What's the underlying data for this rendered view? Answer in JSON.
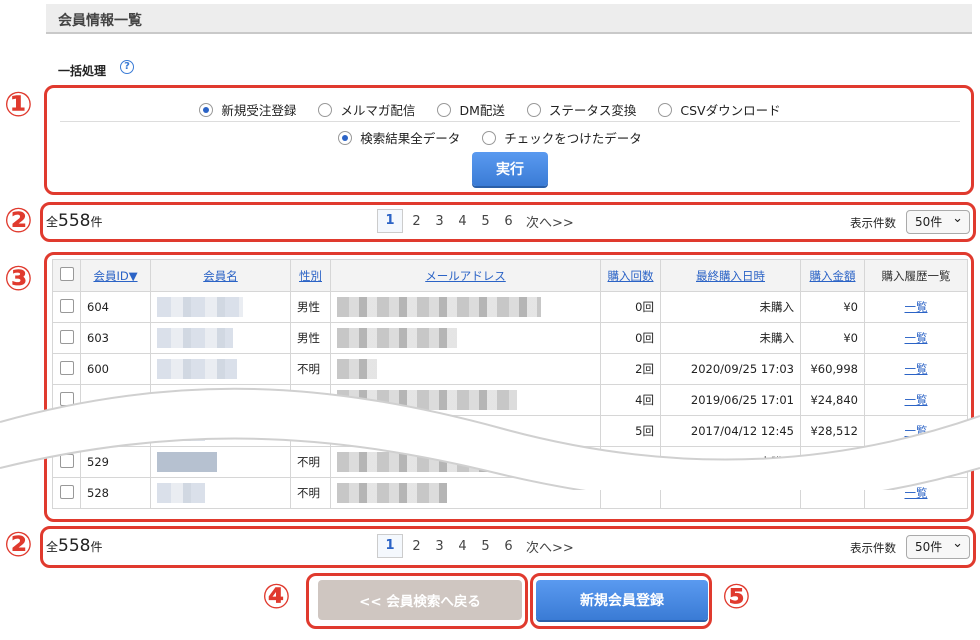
{
  "page": {
    "title": "会員情報一覧"
  },
  "bulk": {
    "label": "一括処理",
    "help_icon": "?",
    "actions": [
      {
        "label": "新規受注登録",
        "selected": true
      },
      {
        "label": "メルマガ配信",
        "selected": false
      },
      {
        "label": "DM配送",
        "selected": false
      },
      {
        "label": "ステータス変換",
        "selected": false
      },
      {
        "label": "CSVダウンロード",
        "selected": false
      }
    ],
    "targets": [
      {
        "label": "検索結果全データ",
        "selected": true
      },
      {
        "label": "チェックをつけたデータ",
        "selected": false
      }
    ],
    "execute_label": "実行"
  },
  "pager": {
    "total_prefix": "全",
    "total_count": "558",
    "total_suffix": "件",
    "pages": [
      "1",
      "2",
      "3",
      "4",
      "5",
      "6"
    ],
    "current": "1",
    "next_label": "次へ>>",
    "per_page_label": "表示件数",
    "per_page_value": "50件"
  },
  "table": {
    "headers": {
      "member_id": "会員ID▼",
      "name": "会員名",
      "gender": "性別",
      "email": "メールアドレス",
      "purchase_count": "購入回数",
      "last_purchase": "最終購入日時",
      "purchase_amount": "購入金額",
      "history": "購入履歴一覧"
    },
    "rows": [
      {
        "id": "604",
        "gender": "男性",
        "count": "0回",
        "last": "未購入",
        "amount": "¥0",
        "history": "一覧"
      },
      {
        "id": "603",
        "gender": "男性",
        "count": "0回",
        "last": "未購入",
        "amount": "¥0",
        "history": "一覧"
      },
      {
        "id": "600",
        "gender": "不明",
        "count": "2回",
        "last": "2020/09/25 17:03",
        "amount": "¥60,998",
        "history": "一覧"
      },
      {
        "id": "",
        "gender": "",
        "count": "4回",
        "last": "2019/06/25 17:01",
        "amount": "¥24,840",
        "history": "一覧"
      },
      {
        "id": "530",
        "gender": "不明",
        "count": "5回",
        "last": "2017/04/12 12:45",
        "amount": "¥28,512",
        "history": "一覧"
      },
      {
        "id": "529",
        "gender": "不明",
        "count": "",
        "last": "未購入",
        "amount": "¥0",
        "history": ""
      },
      {
        "id": "528",
        "gender": "不明",
        "count": "",
        "last": "",
        "amount": "",
        "history": "一覧"
      }
    ]
  },
  "buttons": {
    "back_label": "<< 会員検索へ戻る",
    "register_label": "新規会員登録"
  },
  "annotations": [
    "①",
    "②",
    "③",
    "②",
    "④",
    "⑤"
  ],
  "colors": {
    "annotation_red": "#e03a2e",
    "primary_blue": "#3a7bd5",
    "back_button": "#cfc6c1"
  }
}
